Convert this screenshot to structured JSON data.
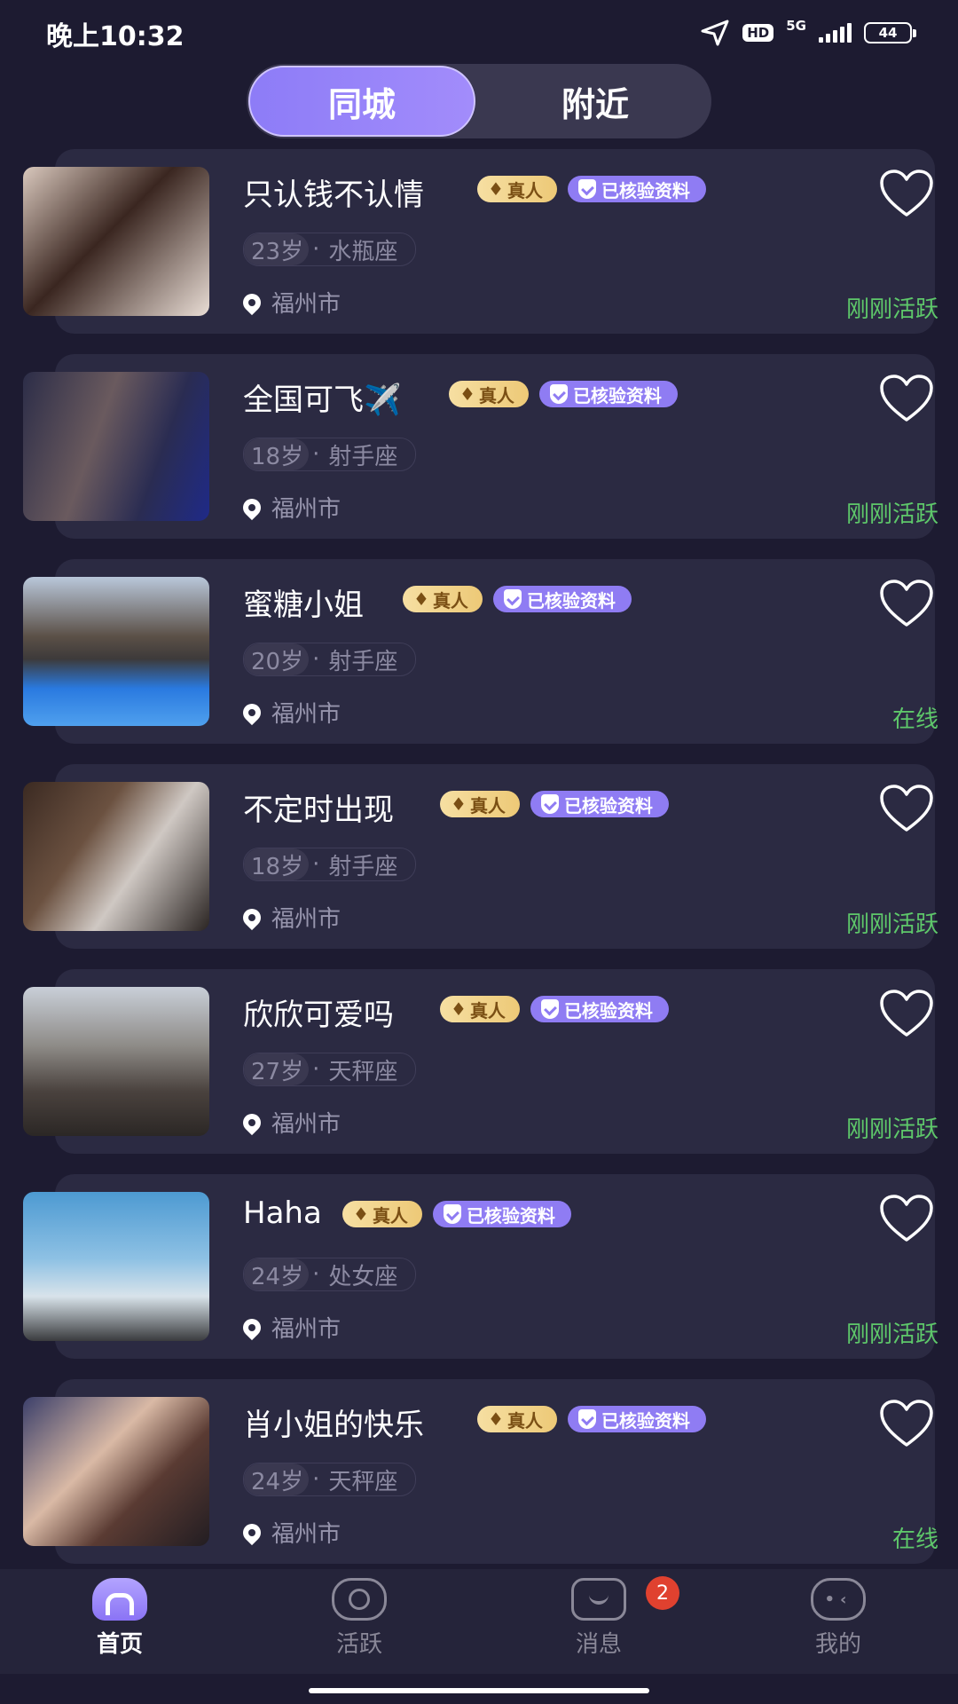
{
  "status_bar": {
    "time": "晚上10:32",
    "hd": "HD",
    "network": "5G",
    "battery": "44"
  },
  "tabs": [
    {
      "label": "同城",
      "active": true
    },
    {
      "label": "附近",
      "active": false
    }
  ],
  "badges": {
    "real": "真人",
    "verified": "已核验资料"
  },
  "colors": {
    "accent": "#8f7cf3",
    "online_green": "#5ec86a",
    "card_bg": "#2b2a42",
    "page_bg": "#1d1b31"
  },
  "profiles": [
    {
      "name": "只认钱不认情",
      "age": "23岁",
      "zodiac": "水瓶座",
      "city": "福州市",
      "activity": "刚刚活跃"
    },
    {
      "name": "全国可飞✈️",
      "age": "18岁",
      "zodiac": "射手座",
      "city": "福州市",
      "activity": "刚刚活跃"
    },
    {
      "name": "蜜糖小姐",
      "age": "20岁",
      "zodiac": "射手座",
      "city": "福州市",
      "activity": "在线"
    },
    {
      "name": "不定时出现",
      "age": "18岁",
      "zodiac": "射手座",
      "city": "福州市",
      "activity": "刚刚活跃"
    },
    {
      "name": "欣欣可爱吗",
      "age": "27岁",
      "zodiac": "天秤座",
      "city": "福州市",
      "activity": "刚刚活跃"
    },
    {
      "name": "Haha",
      "age": "24岁",
      "zodiac": "处女座",
      "city": "福州市",
      "activity": "刚刚活跃"
    },
    {
      "name": "肖小姐的快乐",
      "age": "24岁",
      "zodiac": "天秤座",
      "city": "福州市",
      "activity": "在线"
    }
  ],
  "meta_separator": "·",
  "nav": [
    {
      "label": "首页",
      "icon": "home-icon",
      "active": true
    },
    {
      "label": "活跃",
      "icon": "eye-icon",
      "active": false
    },
    {
      "label": "消息",
      "icon": "message-icon",
      "active": false,
      "badge": "2"
    },
    {
      "label": "我的",
      "icon": "profile-icon",
      "active": false
    }
  ]
}
